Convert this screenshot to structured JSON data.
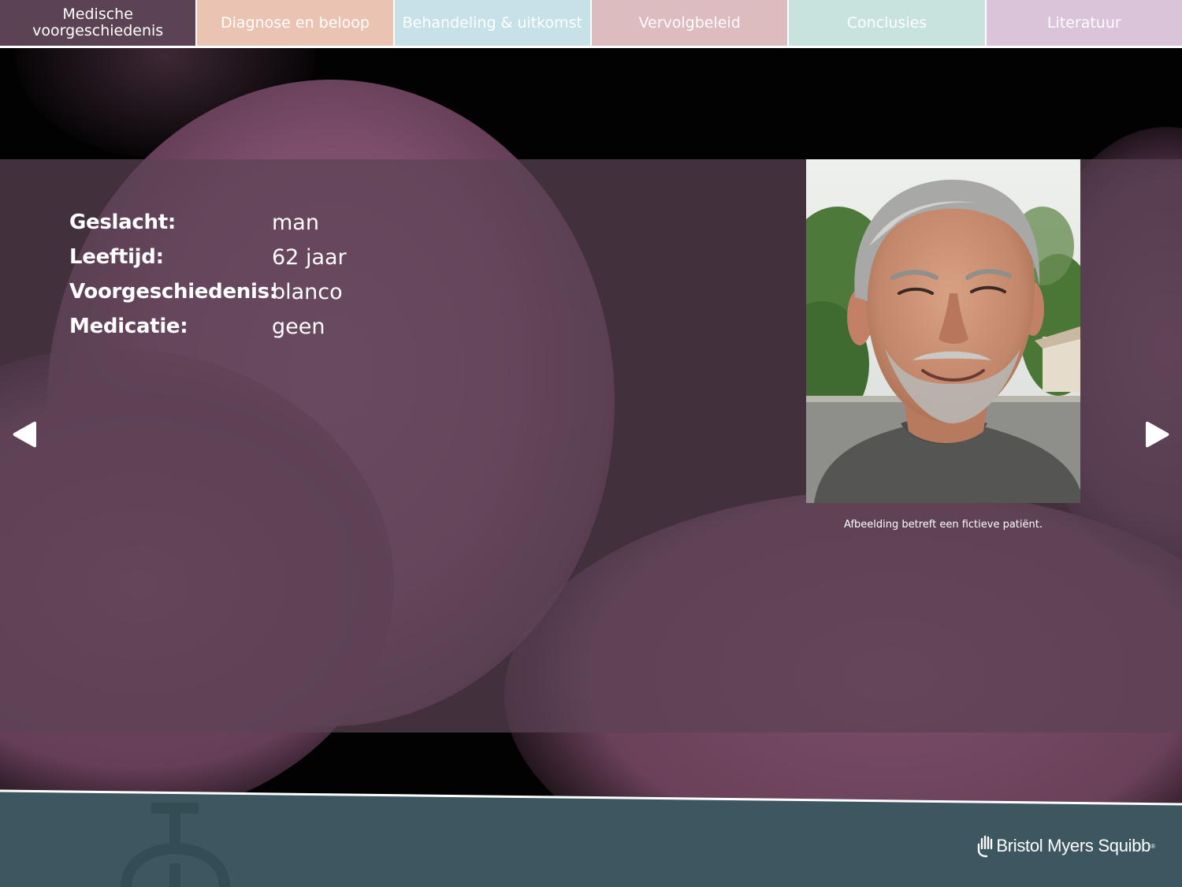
{
  "tabs": [
    {
      "label": "Medische\nvoorgeschiedenis",
      "color": "#5b4353",
      "active": true
    },
    {
      "label": "Diagnose en beloop",
      "color": "#ebc3b2",
      "active": false
    },
    {
      "label": "Behandeling & uitkomst",
      "color": "#c7e1e8",
      "active": false
    },
    {
      "label": "Vervolgbeleid",
      "color": "#dcbcbf",
      "active": false
    },
    {
      "label": "Conclusies",
      "color": "#c8e3de",
      "active": false
    },
    {
      "label": "Literatuur",
      "color": "#dac4da",
      "active": false
    }
  ],
  "patient": {
    "facts": [
      {
        "label": "Geslacht:",
        "value": "man"
      },
      {
        "label": "Leeftijd:",
        "value": "62 jaar"
      },
      {
        "label": "Voorgeschiedenis:",
        "value": "blanco"
      },
      {
        "label": "Medicatie:",
        "value": "geen"
      }
    ],
    "photo_caption": "Afbeelding betreft een fictieve patiënt."
  },
  "navigation": {
    "prev_icon": "arrow-left-icon",
    "next_icon": "arrow-right-icon"
  },
  "footer": {
    "brand": "Bristol Myers Squibb",
    "brand_mark": "®",
    "color": "#3c5760"
  }
}
